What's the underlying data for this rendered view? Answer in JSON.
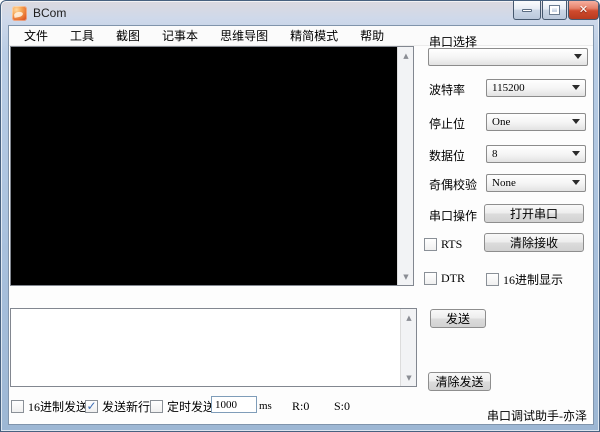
{
  "window": {
    "title": "BCom"
  },
  "menu": {
    "items": [
      "文件",
      "工具",
      "截图",
      "记事本",
      "思维导图",
      "精简模式",
      "帮助"
    ]
  },
  "receive_area": {
    "content": ""
  },
  "send_area": {
    "content": ""
  },
  "serial": {
    "port_label": "串口选择",
    "port_value": "",
    "rows": [
      {
        "label": "波特率",
        "value": "115200"
      },
      {
        "label": "停止位",
        "value": "One"
      },
      {
        "label": "数据位",
        "value": "8"
      },
      {
        "label": "奇偶校验",
        "value": "None"
      }
    ],
    "operation_label": "串口操作",
    "open_button": "打开串口",
    "rts_label": "RTS",
    "clear_receive_button": "清除接收",
    "dtr_label": "DTR",
    "hex_display_label": "16进制显示"
  },
  "send": {
    "send_button": "发送",
    "clear_send_button": "清除发送",
    "hex_send_label": "16进制发送",
    "newline_label": "发送新行",
    "newline_checked": true,
    "timed_send_label": "定时发送",
    "interval_value": "1000",
    "interval_unit": "ms",
    "rx_count": "R:0",
    "tx_count": "S:0"
  },
  "footer": {
    "app_name": "串口调试助手-亦泽"
  },
  "icons": {
    "check": "✓",
    "close": "✕",
    "scroll_up": "▲",
    "scroll_down": "▼"
  },
  "colors": {
    "frame": "#a9c1dd",
    "close_button": "#cf4a2d",
    "console_bg": "#000000",
    "check": "#3b6cb5",
    "app_icon": "#e2622a"
  }
}
